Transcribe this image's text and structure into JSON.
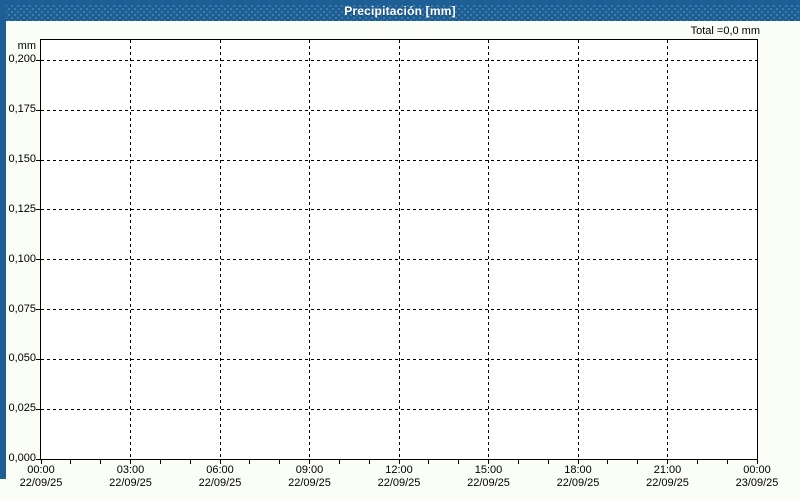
{
  "window": {
    "title": "Precipitación [mm]"
  },
  "annotations": {
    "total": "Total =0,0 mm"
  },
  "chart_data": {
    "type": "bar",
    "title": "Precipitación [mm]",
    "unit_label": "mm",
    "xlabel": "",
    "ylabel": "mm",
    "ylim": [
      0,
      0.21
    ],
    "x_range_hours": 24,
    "grid": "dashed",
    "legend_position": "none",
    "y_ticks": [
      {
        "label": "0,200",
        "value": 0.2
      },
      {
        "label": "0,175",
        "value": 0.175
      },
      {
        "label": "0,150",
        "value": 0.15
      },
      {
        "label": "0,125",
        "value": 0.125
      },
      {
        "label": "0,100",
        "value": 0.1
      },
      {
        "label": "0,075",
        "value": 0.075
      },
      {
        "label": "0,050",
        "value": 0.05
      },
      {
        "label": "0,025",
        "value": 0.025
      },
      {
        "label": "0,000",
        "value": 0.0
      }
    ],
    "x_ticks": [
      {
        "hour": 0,
        "time": "00:00",
        "date": "22/09/25"
      },
      {
        "hour": 3,
        "time": "03:00",
        "date": "22/09/25"
      },
      {
        "hour": 6,
        "time": "06:00",
        "date": "22/09/25"
      },
      {
        "hour": 9,
        "time": "09:00",
        "date": "22/09/25"
      },
      {
        "hour": 12,
        "time": "12:00",
        "date": "22/09/25"
      },
      {
        "hour": 15,
        "time": "15:00",
        "date": "22/09/25"
      },
      {
        "hour": 18,
        "time": "18:00",
        "date": "22/09/25"
      },
      {
        "hour": 21,
        "time": "21:00",
        "date": "22/09/25"
      },
      {
        "hour": 24,
        "time": "00:00",
        "date": "23/09/25"
      }
    ],
    "minor_x_tick_every_hours": 1,
    "series": [
      {
        "name": "Precipitación",
        "values": [],
        "total_label": "0,0 mm"
      }
    ],
    "total_mm": 0.0
  },
  "colors": {
    "titlebar": "#1d5f94",
    "frame": "#1d5f94",
    "plot_background": "#ffffff",
    "outer_background": "#fbfdf7",
    "grid": "#000000",
    "text": "#000000",
    "title_text": "#ffffff"
  }
}
